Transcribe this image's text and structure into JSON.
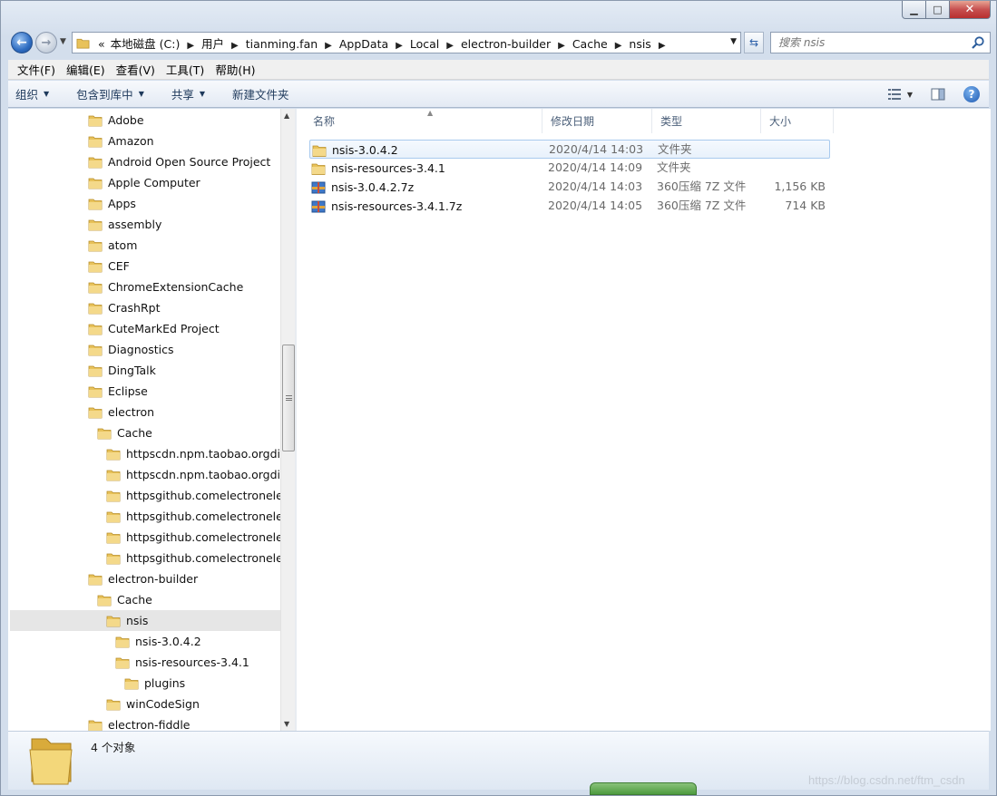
{
  "window": {
    "min_glyph": "▁",
    "max_glyph": "□",
    "close_glyph": "✕"
  },
  "address": {
    "crumbs": [
      "«",
      "本地磁盘 (C:)",
      "用户",
      "tianming.fan",
      "AppData",
      "Local",
      "electron-builder",
      "Cache",
      "nsis"
    ],
    "separator": "▶"
  },
  "search": {
    "placeholder": "搜索 nsis"
  },
  "menu": [
    "文件(F)",
    "编辑(E)",
    "查看(V)",
    "工具(T)",
    "帮助(H)"
  ],
  "commands": {
    "organize": "组织",
    "include_library": "包含到库中",
    "share": "共享",
    "new_folder": "新建文件夹"
  },
  "tree": [
    "Adobe",
    "Amazon",
    "Android Open Source Project",
    "Apple Computer",
    "Apps",
    "assembly",
    "atom",
    "CEF",
    "ChromeExtensionCache",
    "CrashRpt",
    "CuteMarkEd Project",
    "Diagnostics",
    "DingTalk",
    "Eclipse",
    "electron",
    "Cache",
    "httpscdn.npm.taobao.orgdist",
    "httpscdn.npm.taobao.orgdist",
    "httpsgithub.comelectronelect",
    "httpsgithub.comelectronelect",
    "httpsgithub.comelectronelect",
    "httpsgithub.comelectronelect",
    "electron-builder",
    "Cache",
    "nsis",
    "nsis-3.0.4.2",
    "nsis-resources-3.4.1",
    "plugins",
    "winCodeSign",
    "electron-fiddle"
  ],
  "columns": {
    "name": "名称",
    "date": "修改日期",
    "type": "类型",
    "size": "大小"
  },
  "files": [
    {
      "name": "nsis-3.0.4.2",
      "date": "2020/4/14 14:03",
      "type": "文件夹",
      "size": "",
      "kind": "folder-icon"
    },
    {
      "name": "nsis-resources-3.4.1",
      "date": "2020/4/14 14:09",
      "type": "文件夹",
      "size": "",
      "kind": "folder-icon"
    },
    {
      "name": "nsis-3.0.4.2.7z",
      "date": "2020/4/14 14:03",
      "type": "360压缩 7Z 文件",
      "size": "1,156 KB",
      "kind": "archive-icon"
    },
    {
      "name": "nsis-resources-3.4.1.7z",
      "date": "2020/4/14 14:05",
      "type": "360压缩 7Z 文件",
      "size": "714 KB",
      "kind": "archive-icon"
    }
  ],
  "status": {
    "count": "4 个对象"
  },
  "watermark": "https://blog.csdn.net/ftm_csdn",
  "colors": {
    "accent": "#2e6cc1",
    "selection_border": "#a9caee",
    "folder": "#e8c25a"
  }
}
